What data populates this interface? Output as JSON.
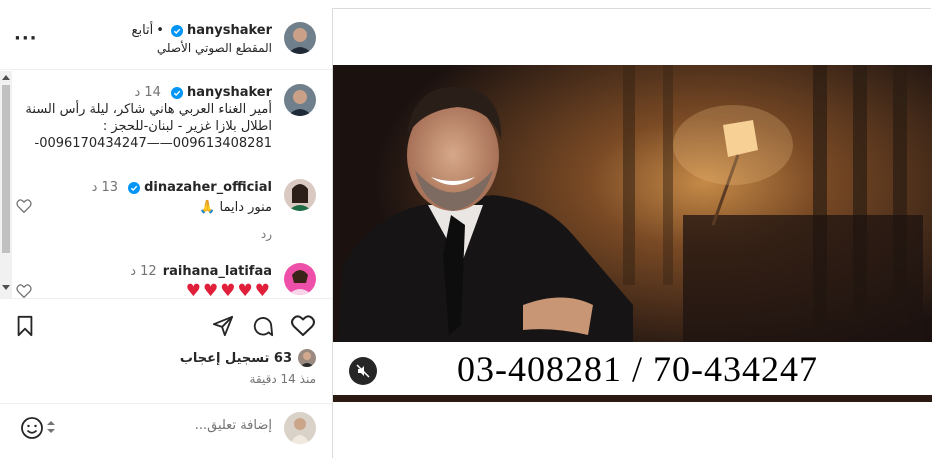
{
  "header": {
    "username": "hanyshaker",
    "dot": "•",
    "follow_label": "أتابع",
    "audio_label": "المقطع الصوتي الأصلي",
    "more_label": "···"
  },
  "caption": {
    "username": "hanyshaker",
    "time": "14 د",
    "text": "أمير الغناء العربي هاني شاكر، ليلة رأس السنة اطلال بلازا غزير - لبنان-للحجز : 009613408281——0096170434247-"
  },
  "comments": [
    {
      "username": "dinazaher_official",
      "time": "13 د",
      "text": "منور دايما 🙏",
      "reply_label": "رد"
    },
    {
      "username": "raihana_latifaa",
      "time": "12 د",
      "text": "♥♥♥♥♥"
    }
  ],
  "likes": {
    "count_label": "63 تسجيل إعجاب"
  },
  "post_time": "منذ 14 دقيقة",
  "add_comment": {
    "placeholder": "إضافة تعليق..."
  },
  "media": {
    "phone_text": "03-408281 / 70-434247"
  },
  "colors": {
    "accent": "#0095f6",
    "heart": "#ff3040",
    "text": "#262626",
    "muted": "#737373"
  }
}
